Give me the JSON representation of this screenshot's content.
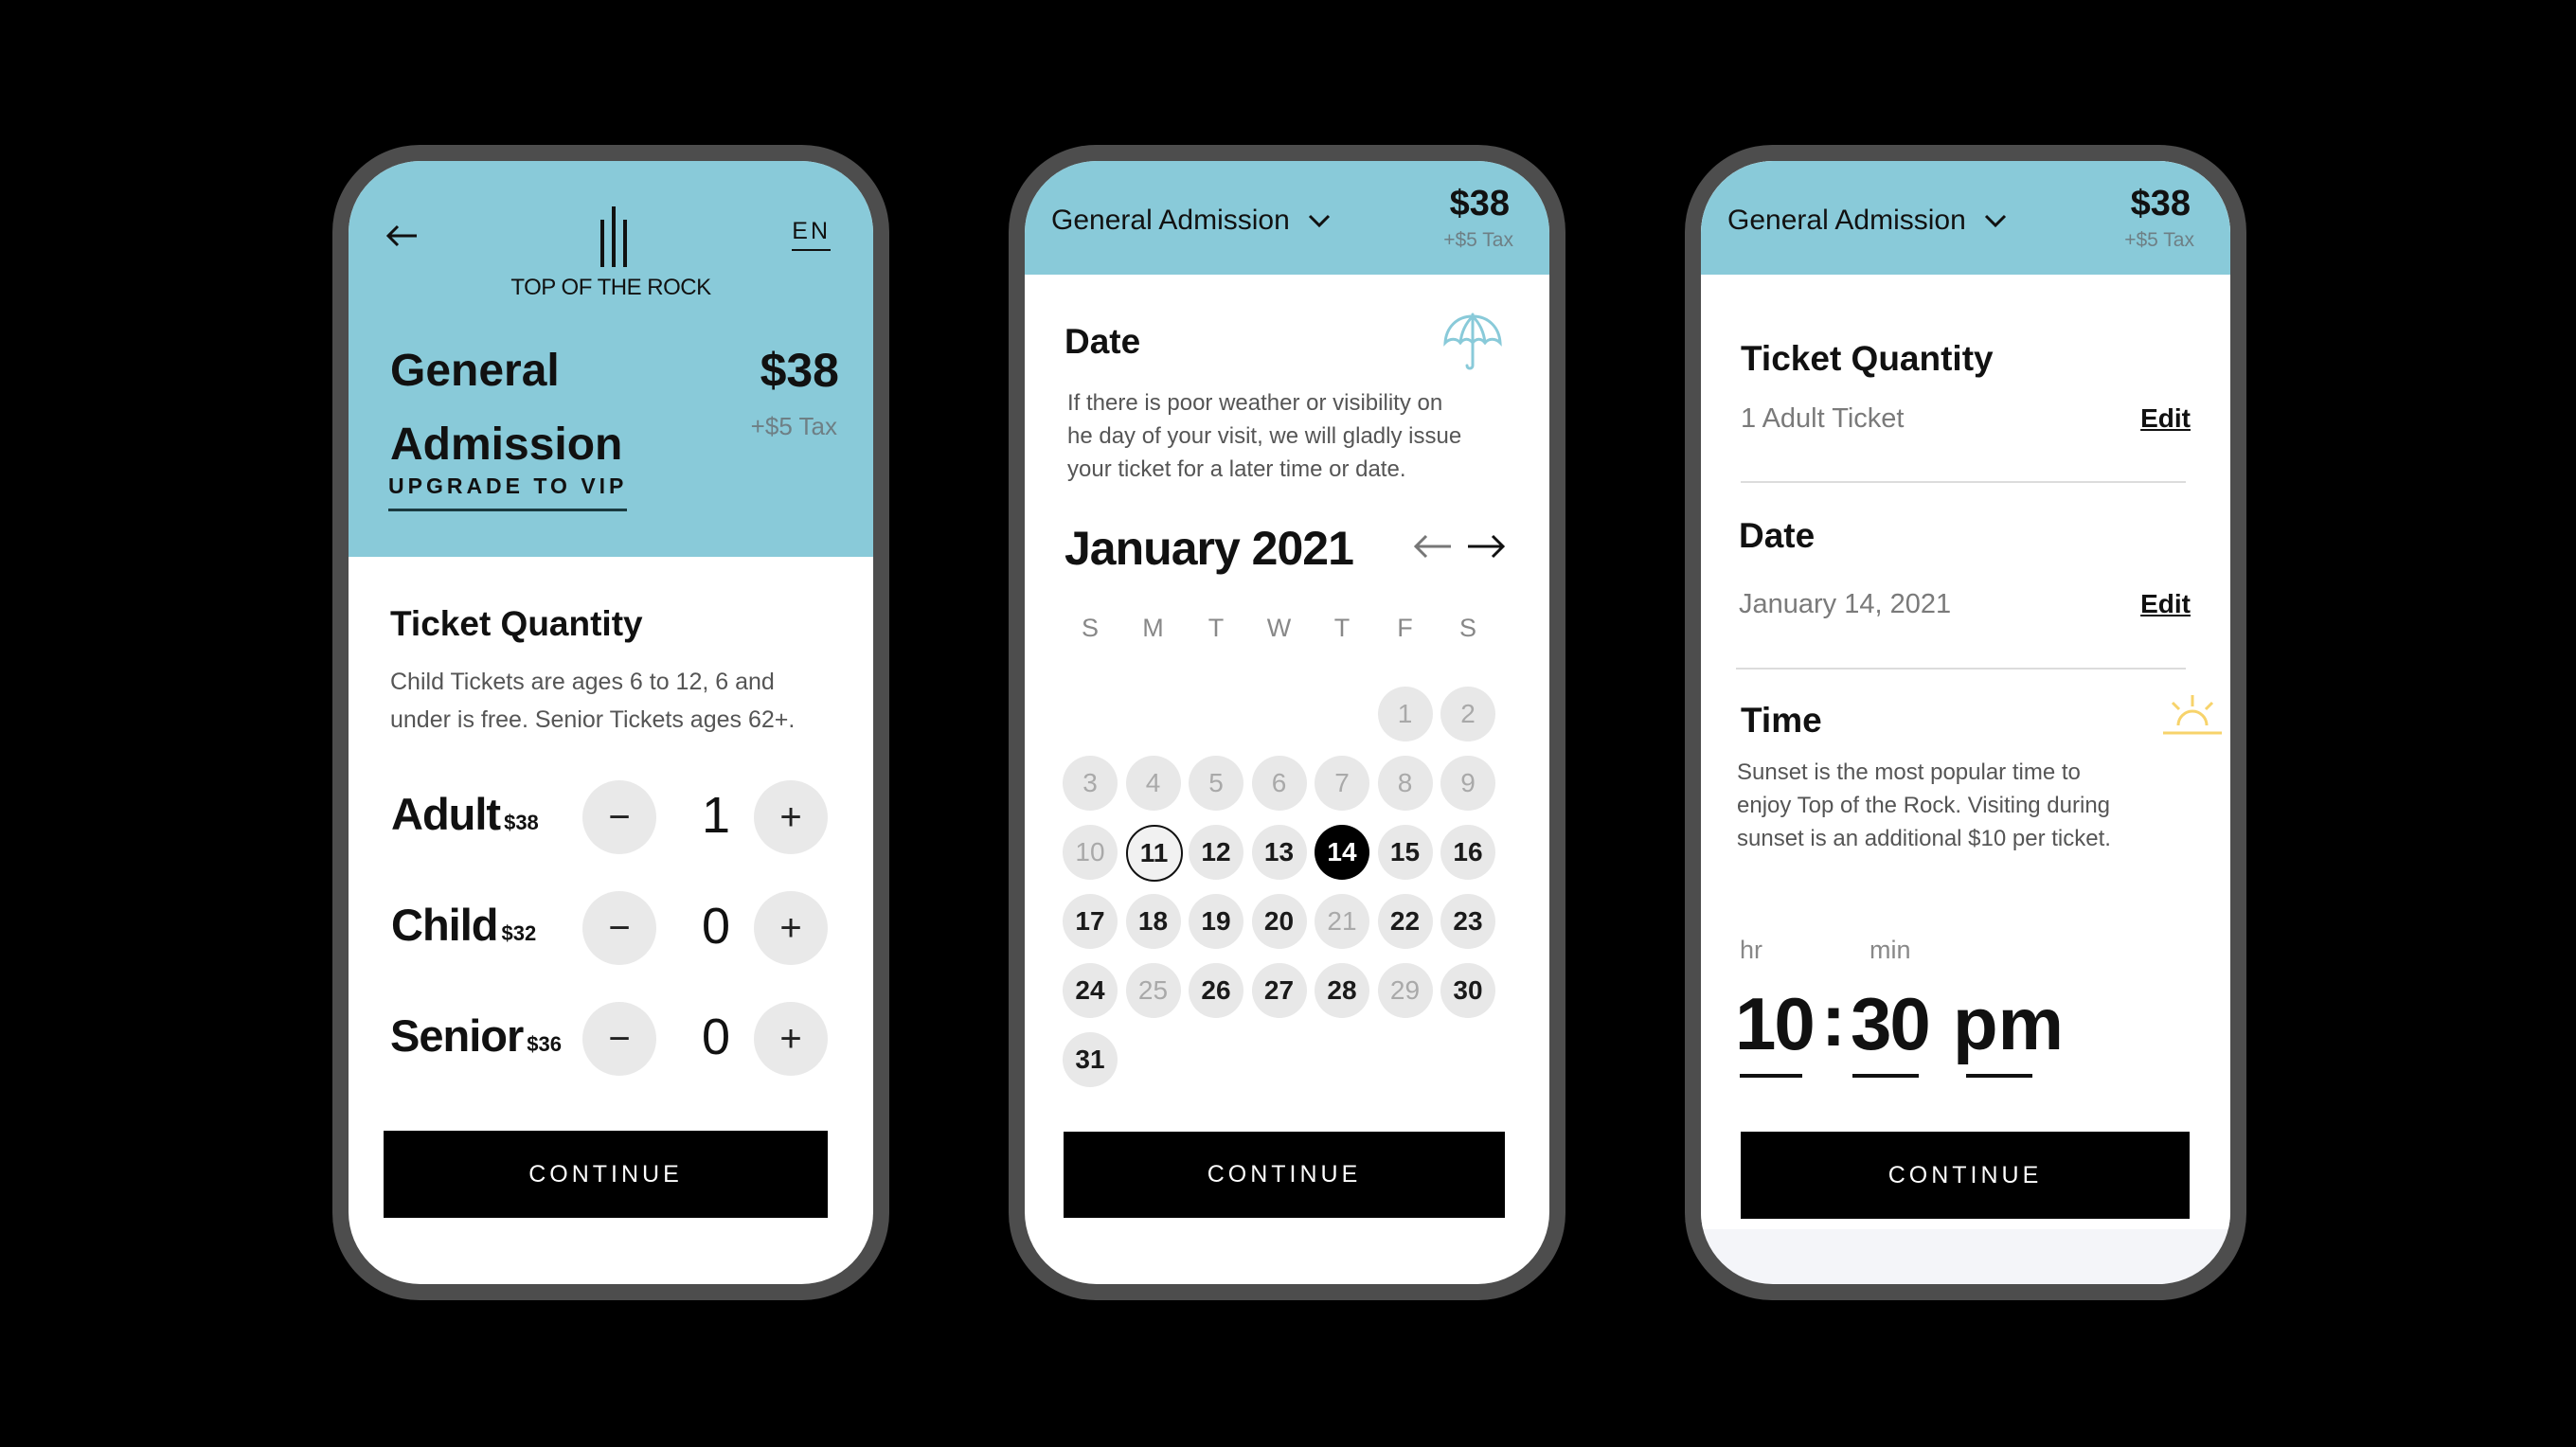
{
  "colors": {
    "header_bg": "#89cad9",
    "accent_umbrella": "#89cad9",
    "accent_sun": "#f7d36b",
    "primary_button": "#000000",
    "selected_day": "#000000",
    "day_bg": "#e8e8e8"
  },
  "screen1": {
    "back_icon": "arrow-left-icon",
    "logo_icon": "top-of-the-rock-bars-logo",
    "logo_text": "TOP OF THE ROCK",
    "language": "EN",
    "title_line1": "General",
    "title_line2": "Admission",
    "price": "$38",
    "tax": "+$5 Tax",
    "upgrade_link": "UPGRADE TO VIP",
    "section_title": "Ticket Quantity",
    "section_desc_line1": "Child Tickets are ages 6 to 12, 6 and",
    "section_desc_line2": "under is free. Senior Tickets ages 62+.",
    "tickets": [
      {
        "label": "Adult",
        "price": "$38",
        "quantity": "1",
        "minus": "−",
        "plus": "+"
      },
      {
        "label": "Child",
        "price": "$32",
        "quantity": "0",
        "minus": "−",
        "plus": "+"
      },
      {
        "label": "Senior",
        "price": "$36",
        "quantity": "0",
        "minus": "−",
        "plus": "+"
      }
    ],
    "continue_label": "CONTINUE"
  },
  "screen2": {
    "ticket_type": "General Admission",
    "dropdown_icon": "chevron-down-icon",
    "price": "$38",
    "tax": "+$5 Tax",
    "section_title": "Date",
    "weather_icon": "umbrella-icon",
    "desc_line1": "If there is poor weather or visibility on",
    "desc_line2": "he day of your visit, we will gladly issue",
    "desc_line3": "your ticket for a later time or date.",
    "month_label": "January 2021",
    "prev_icon": "arrow-left-icon",
    "next_icon": "arrow-right-icon",
    "weekdays": [
      "S",
      "M",
      "T",
      "W",
      "T",
      "F",
      "S"
    ],
    "first_weekday_index": 5,
    "days": [
      {
        "d": "1",
        "state": "disabled"
      },
      {
        "d": "2",
        "state": "disabled"
      },
      {
        "d": "3",
        "state": "disabled"
      },
      {
        "d": "4",
        "state": "disabled"
      },
      {
        "d": "5",
        "state": "disabled"
      },
      {
        "d": "6",
        "state": "disabled"
      },
      {
        "d": "7",
        "state": "disabled"
      },
      {
        "d": "8",
        "state": "disabled"
      },
      {
        "d": "9",
        "state": "disabled"
      },
      {
        "d": "10",
        "state": "disabled"
      },
      {
        "d": "11",
        "state": "today"
      },
      {
        "d": "12",
        "state": "available"
      },
      {
        "d": "13",
        "state": "available"
      },
      {
        "d": "14",
        "state": "selected"
      },
      {
        "d": "15",
        "state": "available"
      },
      {
        "d": "16",
        "state": "available"
      },
      {
        "d": "17",
        "state": "available"
      },
      {
        "d": "18",
        "state": "available"
      },
      {
        "d": "19",
        "state": "available"
      },
      {
        "d": "20",
        "state": "available"
      },
      {
        "d": "21",
        "state": "disabled"
      },
      {
        "d": "22",
        "state": "available"
      },
      {
        "d": "23",
        "state": "available"
      },
      {
        "d": "24",
        "state": "available"
      },
      {
        "d": "25",
        "state": "disabled"
      },
      {
        "d": "26",
        "state": "available"
      },
      {
        "d": "27",
        "state": "available"
      },
      {
        "d": "28",
        "state": "available"
      },
      {
        "d": "29",
        "state": "disabled"
      },
      {
        "d": "30",
        "state": "available"
      },
      {
        "d": "31",
        "state": "available"
      }
    ],
    "selected_date": "14",
    "continue_label": "CONTINUE"
  },
  "screen3": {
    "ticket_type": "General Admission",
    "dropdown_icon": "chevron-down-icon",
    "price": "$38",
    "tax": "+$5 Tax",
    "quantity_title": "Ticket Quantity",
    "quantity_value": "1 Adult Ticket",
    "quantity_edit": "Edit",
    "date_title": "Date",
    "date_value": "January 14, 2021",
    "date_edit": "Edit",
    "time_title": "Time",
    "time_icon": "sunset-icon",
    "time_desc_line1": "Sunset is the most popular time to",
    "time_desc_line2": "enjoy Top of the Rock. Visiting during",
    "time_desc_line3": "sunset is an additional $10 per ticket.",
    "hr_label": "hr",
    "min_label": "min",
    "hour": "10",
    "separator": ":",
    "minute": "30",
    "ampm": "pm",
    "continue_label": "CONTINUE"
  }
}
